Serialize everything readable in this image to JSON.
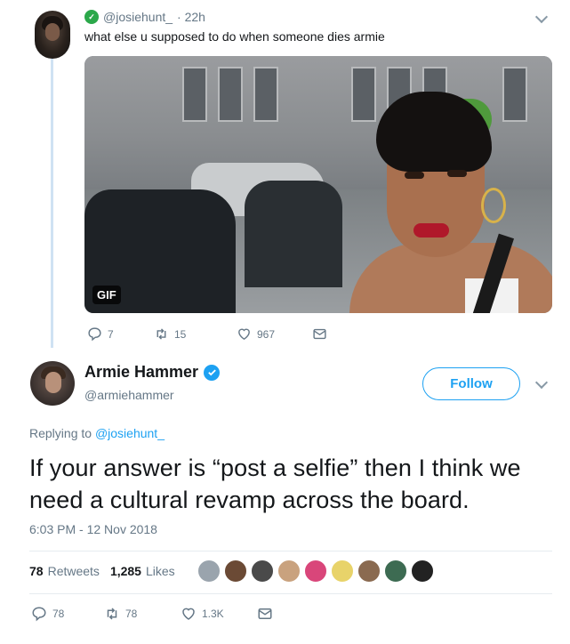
{
  "reply_context": {
    "handle": "@josiehunt_",
    "time": "· 22h",
    "text": "what else u supposed to do when someone dies armie",
    "media_badge": "GIF",
    "actions": {
      "replies": "7",
      "retweets": "15",
      "likes": "967"
    }
  },
  "main_tweet": {
    "display_name": "Armie Hammer",
    "handle": "@armiehammer",
    "follow_label": "Follow",
    "replying_prefix": "Replying to",
    "replying_to": "@josiehunt_",
    "text": "If your answer is “post a selfie” then I think we need a cultural revamp across the board.",
    "timestamp": "6:03 PM - 12 Nov 2018",
    "retweets_count": "78",
    "retweets_label": "Retweets",
    "likes_count": "1,285",
    "likes_label": "Likes",
    "actions": {
      "replies": "78",
      "retweets": "78",
      "likes": "1.3K"
    }
  },
  "colors": {
    "accent": "#1da1f2",
    "muted": "#657786",
    "text": "#14171a",
    "divider": "#e6ecf0"
  },
  "icons": [
    "reply-icon",
    "retweet-icon",
    "heart-icon",
    "dm-icon",
    "verified-badge-icon",
    "chevron-down-icon"
  ]
}
